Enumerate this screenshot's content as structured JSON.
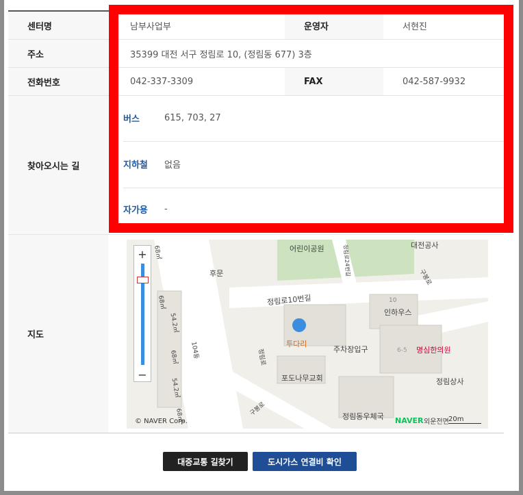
{
  "info": {
    "center_label": "센터명",
    "center_name": "남부사업부",
    "operator_label": "운영자",
    "operator_name": "서현진",
    "address_label": "주소",
    "address": "35399 대전 서구 정림로 10,  (정림동 677)  3층",
    "phone_label": "전화번호",
    "phone": "042-337-3309",
    "fax_label": "FAX",
    "fax": "042-587-9932",
    "directions_label": "찾아오시는 길",
    "bus_label": "버스",
    "bus": "615, 703, 27",
    "subway_label": "지하철",
    "subway": "없음",
    "car_label": "자가용",
    "car": "-",
    "map_label": "지도"
  },
  "map": {
    "labels": {
      "park": "어린이공원",
      "daejeon": "대전공사",
      "hoomun": "후문",
      "road10": "정림로10번길",
      "inha": "인하우스",
      "tudari": "투다리",
      "parking": "주차장입구",
      "myungsim": "명심한의원",
      "podo": "포도나무교회",
      "jeongrim_sangsa": "정림상사",
      "gym": "정림동우체국",
      "jeongrimro": "정림로",
      "gubongro": "구봉로",
      "gubongro2": "구봉로",
      "copyright": "© NAVER Corp.",
      "naver": "NAVER",
      "scale": "20m",
      "bldg104": "104동",
      "area1": "68㎡",
      "area2": "54.2㎡",
      "area3": "68㎡",
      "area4": "54.2㎡",
      "area5": "68㎡",
      "area6": "68㎡",
      "num10": "10",
      "num65": "6-5",
      "road24": "정림로24번길",
      "sijang": "외운전면"
    },
    "zoom_in": "+",
    "zoom_out": "−"
  },
  "buttons": {
    "transit": "대중교통 길찾기",
    "gas": "도시가스 연결비 확인"
  },
  "colors": {
    "highlight": "#ff0000",
    "transit_button": "#222222",
    "gas_button": "#1f4e96",
    "link_label": "#1f5aa8"
  }
}
